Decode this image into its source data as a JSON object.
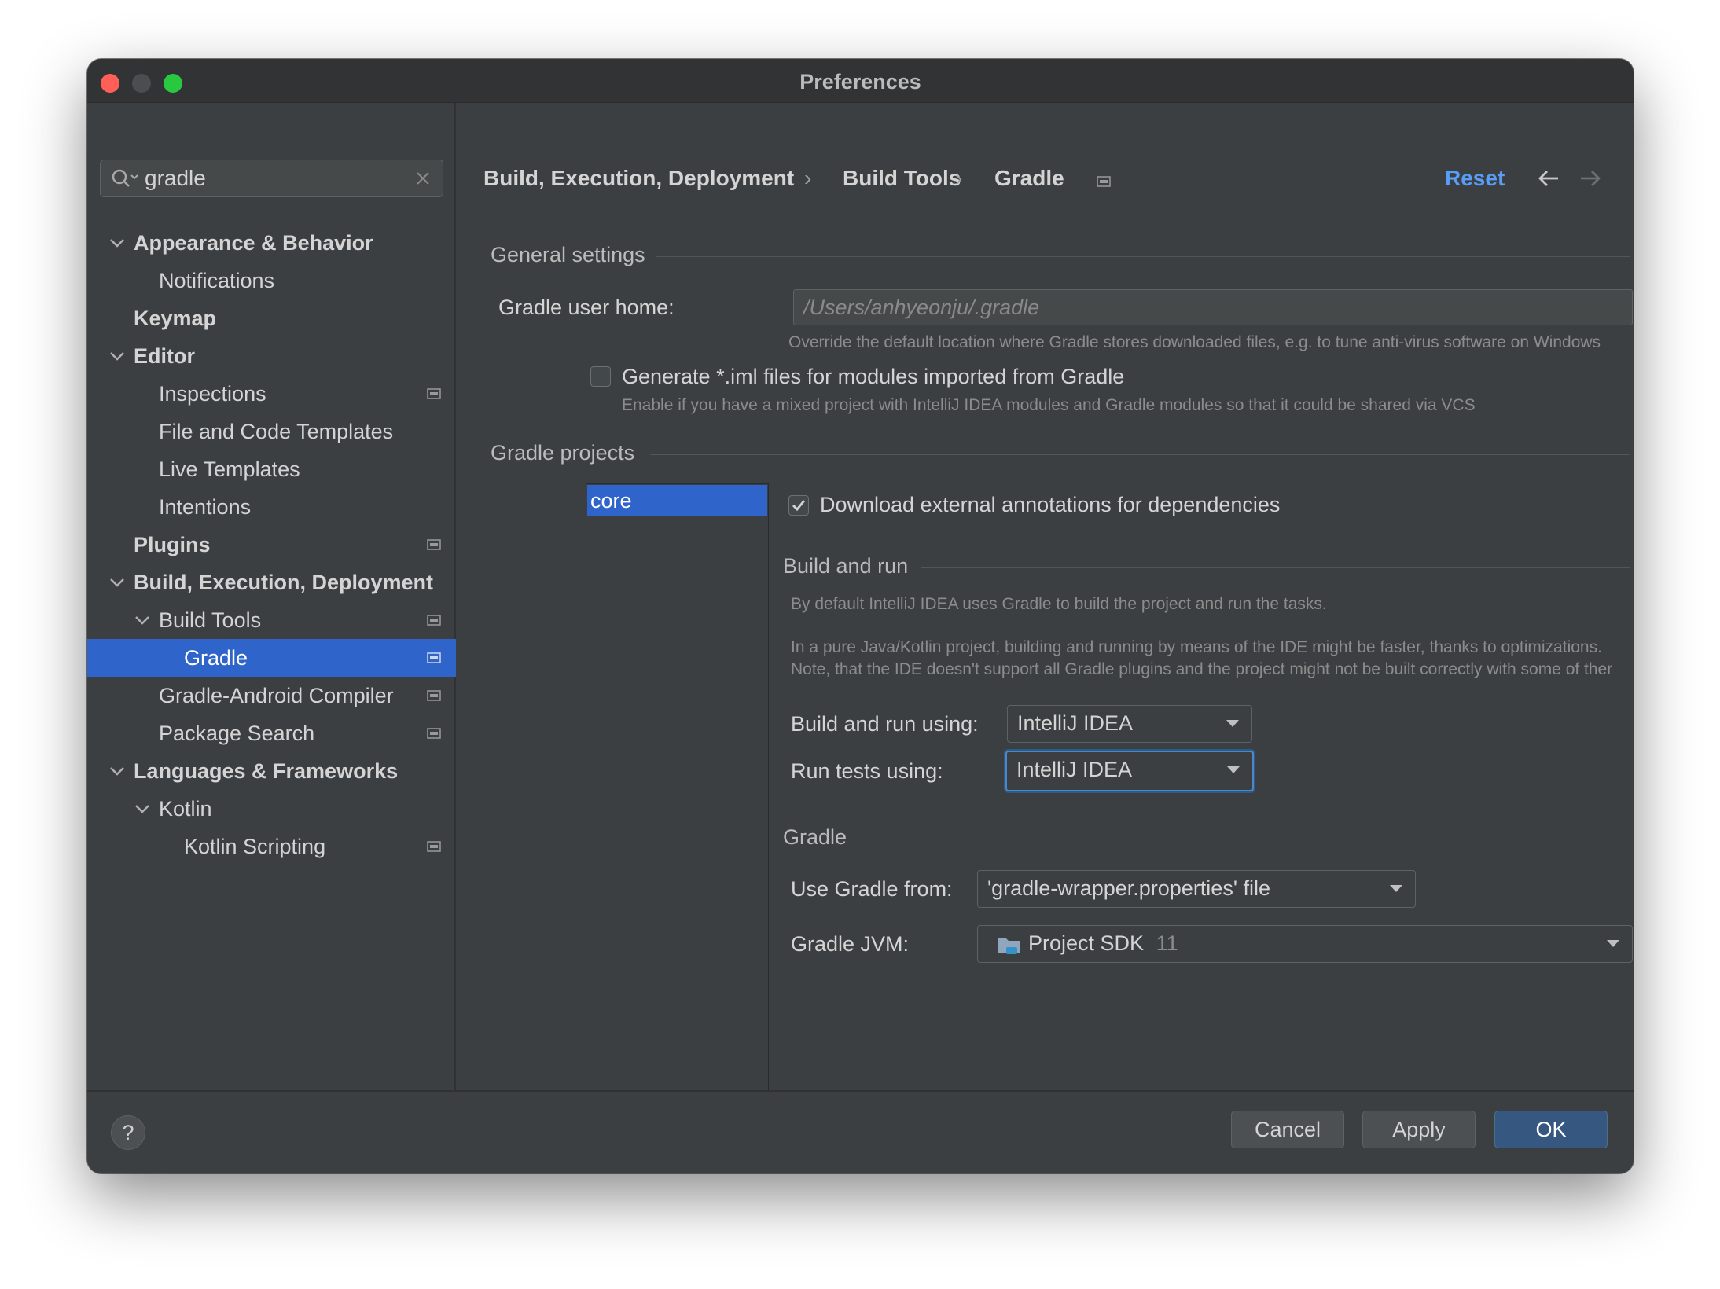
{
  "window": {
    "title": "Preferences"
  },
  "search": {
    "value": "gradle"
  },
  "sidebar": {
    "items": [
      {
        "label": "Appearance & Behavior"
      },
      {
        "label": "Notifications"
      },
      {
        "label": "Keymap"
      },
      {
        "label": "Editor"
      },
      {
        "label": "Inspections"
      },
      {
        "label": "File and Code Templates"
      },
      {
        "label": "Live Templates"
      },
      {
        "label": "Intentions"
      },
      {
        "label": "Plugins"
      },
      {
        "label": "Build, Execution, Deployment"
      },
      {
        "label": "Build Tools"
      },
      {
        "label": "Gradle"
      },
      {
        "label": "Gradle-Android Compiler"
      },
      {
        "label": "Package Search"
      },
      {
        "label": "Languages & Frameworks"
      },
      {
        "label": "Kotlin"
      },
      {
        "label": "Kotlin Scripting"
      }
    ]
  },
  "breadcrumb": {
    "items": [
      "Build, Execution, Deployment",
      "Build Tools",
      "Gradle"
    ],
    "separator": "›"
  },
  "header": {
    "reset_label": "Reset"
  },
  "general": {
    "title": "General settings",
    "home_label": "Gradle user home:",
    "home_placeholder": "/Users/anhyeonju/.gradle",
    "home_hint": "Override the default location where Gradle stores downloaded files, e.g. to tune anti-virus software on Windows",
    "iml_label": "Generate *.iml files for modules imported from Gradle",
    "iml_hint": "Enable if you have a mixed project with IntelliJ IDEA modules and Gradle modules so that it could be shared via VCS",
    "iml_checked": false
  },
  "projects": {
    "title": "Gradle projects",
    "list": [
      "core"
    ],
    "download_label": "Download external annotations for dependencies",
    "download_checked": true
  },
  "build_run": {
    "title": "Build and run",
    "desc1": "By default IntelliJ IDEA uses Gradle to build the project and run the tasks.",
    "desc2": "In a pure Java/Kotlin project, building and running by means of the IDE might be faster, thanks to optimizations.",
    "desc3": "Note, that the IDE doesn't support all Gradle plugins and the project might not be built correctly with some of ther",
    "build_using_label": "Build and run using:",
    "build_using_value": "IntelliJ IDEA",
    "tests_using_label": "Run tests using:",
    "tests_using_value": "IntelliJ IDEA"
  },
  "gradle": {
    "title": "Gradle",
    "use_from_label": "Use Gradle from:",
    "use_from_value": "'gradle-wrapper.properties' file",
    "jvm_label": "Gradle JVM:",
    "jvm_value": "Project SDK",
    "jvm_version": "11"
  },
  "footer": {
    "help_label": "?",
    "cancel_label": "Cancel",
    "apply_label": "Apply",
    "ok_label": "OK"
  },
  "colors": {
    "selection": "#2f65ca",
    "link": "#589df6",
    "primary_button": "#365880"
  }
}
